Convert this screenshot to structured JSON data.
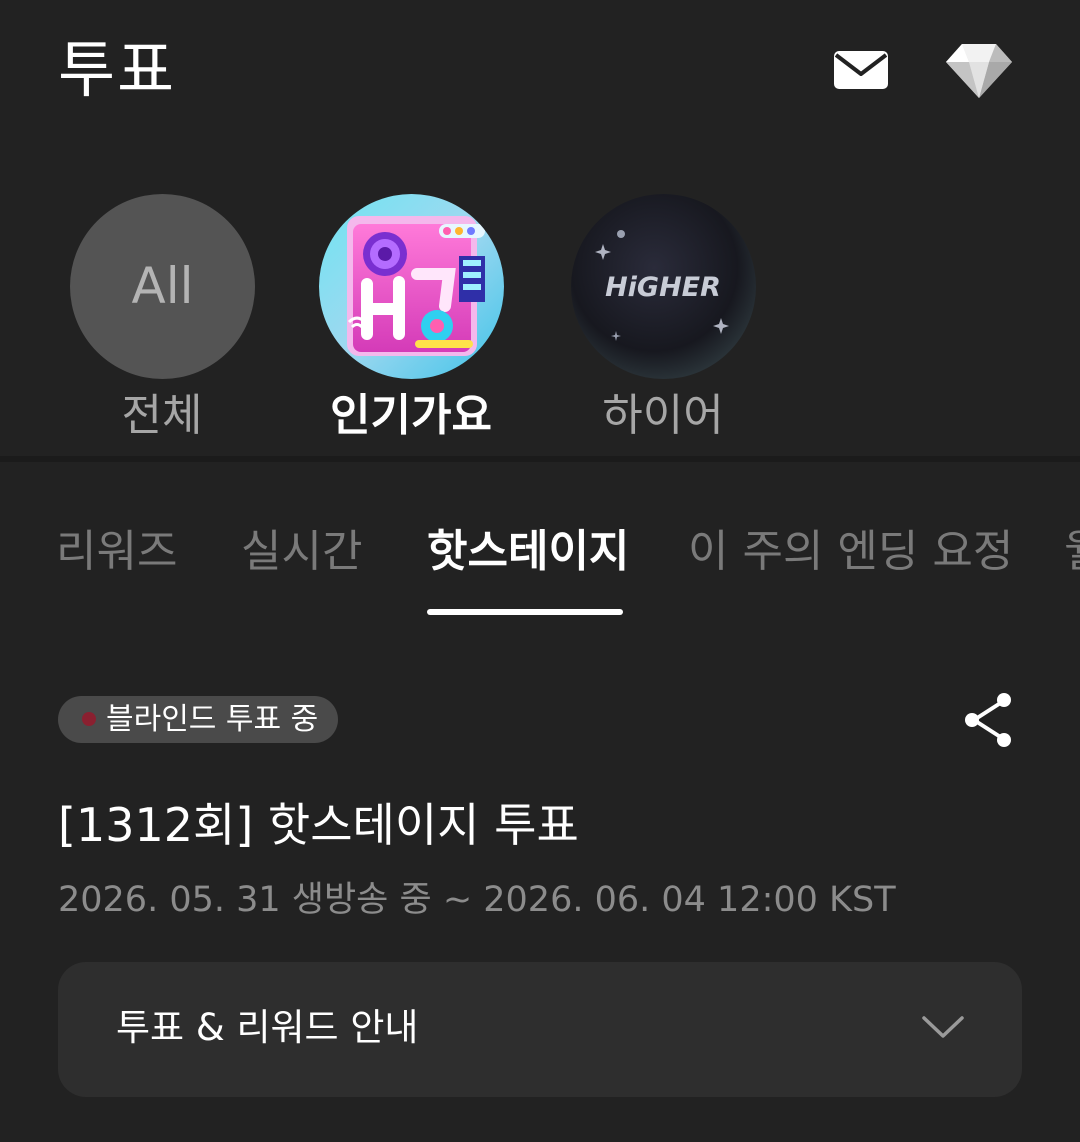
{
  "header": {
    "title": "투표",
    "mail_icon": "envelope-icon",
    "gem_icon": "diamond-icon"
  },
  "programs": [
    {
      "key": "all",
      "circle_text": "All",
      "label": "전체",
      "selected": false
    },
    {
      "key": "inkigayo",
      "label": "인기가요",
      "selected": true
    },
    {
      "key": "higher",
      "logo_text": "HiGHER",
      "label": "하이어",
      "selected": false
    }
  ],
  "tabs": [
    {
      "label": "리워즈",
      "active": false
    },
    {
      "label": "실시간",
      "active": false
    },
    {
      "label": "핫스테이지",
      "active": true
    },
    {
      "label": "이 주의 엔딩 요정",
      "active": false
    },
    {
      "label": "월",
      "active": false
    }
  ],
  "vote": {
    "status": "블라인드 투표 중",
    "title": "[1312회] 핫스테이지 투표",
    "period": "2026. 05. 31 생방송 중 ~ 2026. 06. 04 12:00 KST",
    "share_icon": "share-icon"
  },
  "info": {
    "label": "투표 & 리워드 안내",
    "expanded": false
  },
  "colors": {
    "background": "#222222",
    "panel": "#2e2e2e",
    "inactive_text": "#7a7a7a",
    "badge": "#4a4a4a"
  }
}
